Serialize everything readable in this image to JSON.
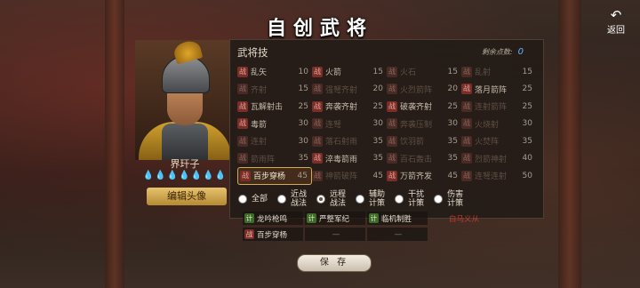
{
  "title": "自创武将",
  "back_label": "返回",
  "general": {
    "name": "界玕子",
    "energy": "💧💧💧💧💧💧💧",
    "edit_button": "编辑头像"
  },
  "panel": {
    "title": "武将技",
    "points_label": "剩余点数:",
    "points_value": "0"
  },
  "skill_grid": [
    [
      {
        "tag": "战",
        "name": "乱矢",
        "cost": "10",
        "dim": false,
        "sel": false
      },
      {
        "tag": "战",
        "name": "火箭",
        "cost": "15",
        "dim": false,
        "sel": false
      },
      {
        "tag": "战",
        "name": "火石",
        "cost": "15",
        "dim": true,
        "sel": false
      },
      {
        "tag": "战",
        "name": "乱射",
        "cost": "15",
        "dim": true,
        "sel": false
      }
    ],
    [
      {
        "tag": "战",
        "name": "齐射",
        "cost": "15",
        "dim": true,
        "sel": false
      },
      {
        "tag": "战",
        "name": "强弩齐射",
        "cost": "20",
        "dim": true,
        "sel": false
      },
      {
        "tag": "战",
        "name": "火烈箭阵",
        "cost": "20",
        "dim": true,
        "sel": false
      },
      {
        "tag": "战",
        "name": "落月箭阵",
        "cost": "25",
        "dim": false,
        "sel": false
      }
    ],
    [
      {
        "tag": "战",
        "name": "瓦解射击",
        "cost": "25",
        "dim": false,
        "sel": false
      },
      {
        "tag": "战",
        "name": "奔袭齐射",
        "cost": "25",
        "dim": false,
        "sel": false
      },
      {
        "tag": "战",
        "name": "破袭齐射",
        "cost": "25",
        "dim": false,
        "sel": false
      },
      {
        "tag": "战",
        "name": "连射箭阵",
        "cost": "25",
        "dim": true,
        "sel": false
      }
    ],
    [
      {
        "tag": "战",
        "name": "毒箭",
        "cost": "30",
        "dim": false,
        "sel": false
      },
      {
        "tag": "战",
        "name": "连弩",
        "cost": "30",
        "dim": true,
        "sel": false
      },
      {
        "tag": "战",
        "name": "奔袭压制",
        "cost": "30",
        "dim": true,
        "sel": false
      },
      {
        "tag": "战",
        "name": "火烧射",
        "cost": "30",
        "dim": true,
        "sel": false
      }
    ],
    [
      {
        "tag": "战",
        "name": "连射",
        "cost": "30",
        "dim": true,
        "sel": false
      },
      {
        "tag": "战",
        "name": "落石射雨",
        "cost": "35",
        "dim": true,
        "sel": false
      },
      {
        "tag": "战",
        "name": "饮羽箭",
        "cost": "35",
        "dim": true,
        "sel": false
      },
      {
        "tag": "战",
        "name": "火焚阵",
        "cost": "35",
        "dim": true,
        "sel": false
      }
    ],
    [
      {
        "tag": "战",
        "name": "箭雨阵",
        "cost": "35",
        "dim": true,
        "sel": false
      },
      {
        "tag": "战",
        "name": "淬毒箭雨",
        "cost": "35",
        "dim": false,
        "sel": false
      },
      {
        "tag": "战",
        "name": "百石轰击",
        "cost": "35",
        "dim": true,
        "sel": false
      },
      {
        "tag": "战",
        "name": "烈箭神射",
        "cost": "40",
        "dim": true,
        "sel": false
      }
    ],
    [
      {
        "tag": "战",
        "name": "百步穿杨",
        "cost": "45",
        "dim": false,
        "sel": true
      },
      {
        "tag": "战",
        "name": "神箭破阵",
        "cost": "45",
        "dim": true,
        "sel": false
      },
      {
        "tag": "战",
        "name": "万箭齐发",
        "cost": "45",
        "dim": false,
        "sel": false
      },
      {
        "tag": "战",
        "name": "连弩连射",
        "cost": "50",
        "dim": true,
        "sel": false
      }
    ]
  ],
  "filters": [
    {
      "label": "全部",
      "on": false
    },
    {
      "label": "近战\n战法",
      "on": false
    },
    {
      "label": "远程\n战法",
      "on": true
    },
    {
      "label": "辅助\n计策",
      "on": false
    },
    {
      "label": "干扰\n计策",
      "on": false
    },
    {
      "label": "伤害\n计策",
      "on": false
    }
  ],
  "equipped": {
    "row1": [
      {
        "tag": "计",
        "name": "龙吟枪鸣"
      },
      {
        "tag": "计",
        "name": "严整军纪"
      },
      {
        "tag": "计",
        "name": "临机制胜"
      },
      {
        "name": "白马义从"
      }
    ],
    "row2": [
      {
        "tag": "战",
        "name": "百步穿杨"
      },
      {
        "name": "—"
      },
      {
        "name": "—"
      }
    ]
  },
  "save_button": "保 存"
}
